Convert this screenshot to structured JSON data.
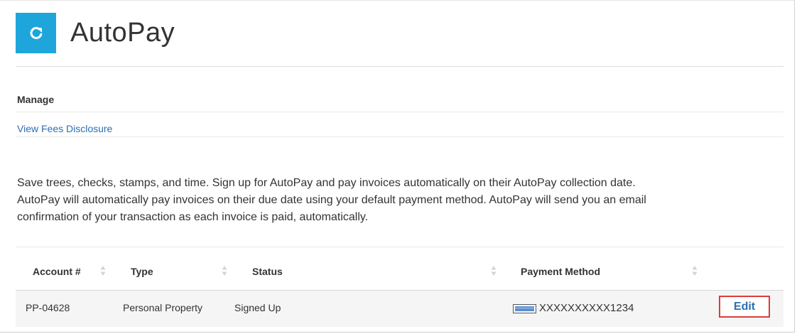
{
  "header": {
    "title": "AutoPay",
    "logo_icon": "refresh-icon",
    "accent_color": "#1ea6dc"
  },
  "manage": {
    "heading": "Manage",
    "fees_link": "View Fees Disclosure"
  },
  "description": "Save trees, checks, stamps, and time. Sign up for AutoPay and pay invoices automatically on their AutoPay collection date.\nAutoPay will automatically pay invoices on their due date using your default payment method. AutoPay will send you an email\nconfirmation of your transaction as each invoice is paid, automatically.",
  "table": {
    "columns": [
      "Account #",
      "Type",
      "Status",
      "Payment Method"
    ],
    "rows": [
      {
        "account": "PP-04628",
        "type": "Personal Property",
        "status": "Signed Up",
        "payment_icon": "credit-card-icon",
        "payment_method": "XXXXXXXXXX1234",
        "action": "Edit"
      }
    ]
  },
  "colors": {
    "link": "#2c6fb3",
    "highlight_border": "#e03a3a"
  }
}
